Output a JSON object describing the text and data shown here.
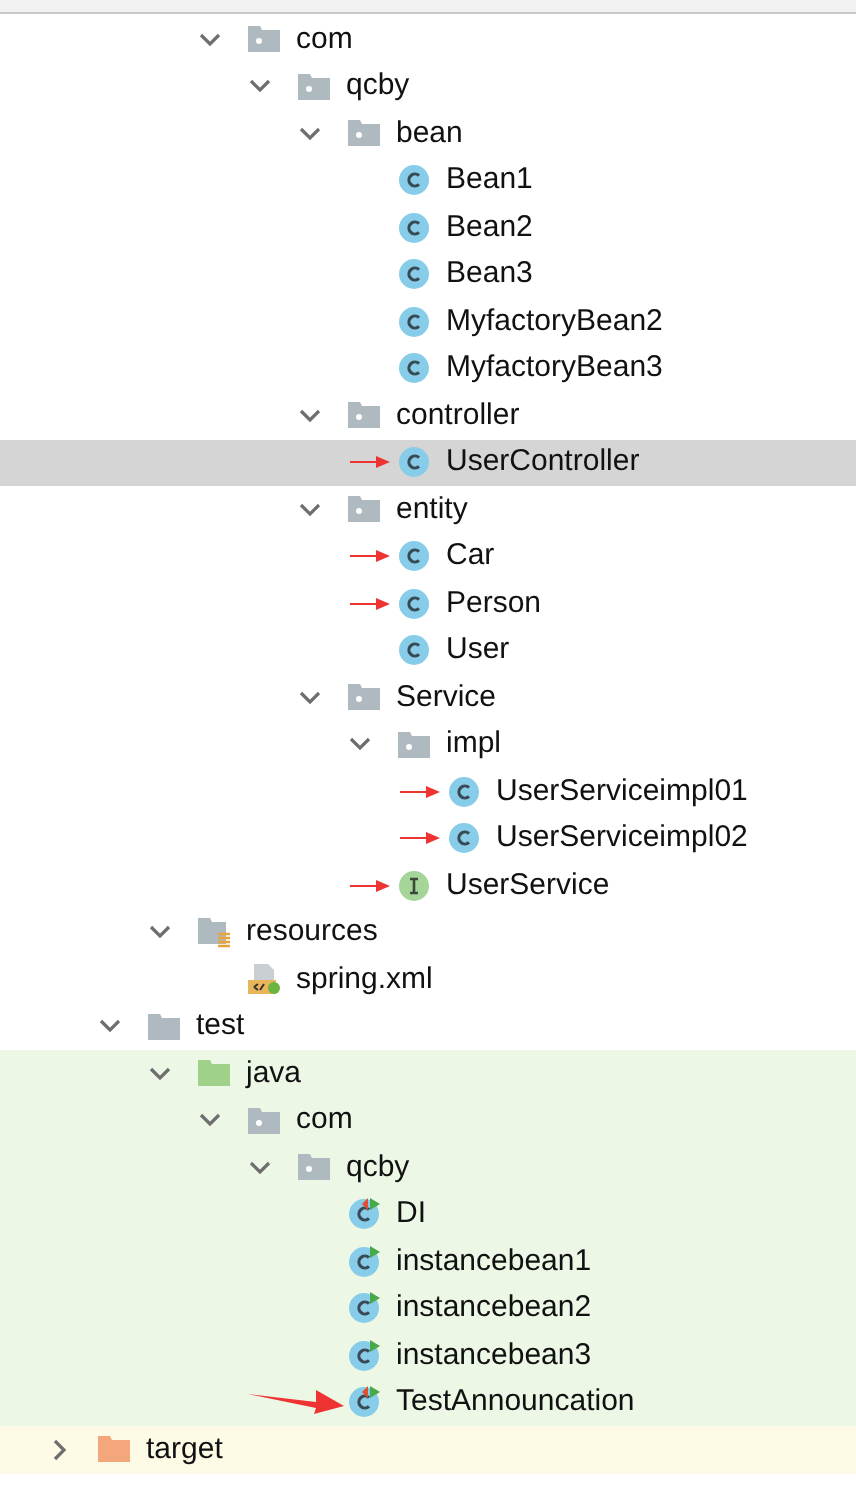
{
  "tree": [
    {
      "children": [
        {
          "children": [
            {
              "children": [
                {
                  "label": "com",
                  "kind": "package",
                  "expanded": true,
                  "selected": false,
                  "marked": false,
                  "children": [
                    {
                      "label": "qcby",
                      "kind": "package",
                      "expanded": true,
                      "selected": false,
                      "marked": false,
                      "children": [
                        {
                          "label": "bean",
                          "kind": "package",
                          "expanded": true,
                          "selected": false,
                          "marked": false,
                          "children": [
                            {
                              "label": "Bean1",
                              "kind": "class",
                              "selected": false,
                              "marked": false
                            },
                            {
                              "label": "Bean2",
                              "kind": "class",
                              "selected": false,
                              "marked": false
                            },
                            {
                              "label": "Bean3",
                              "kind": "class",
                              "selected": false,
                              "marked": false
                            },
                            {
                              "label": "MyfactoryBean2",
                              "kind": "class",
                              "selected": false,
                              "marked": false
                            },
                            {
                              "label": "MyfactoryBean3",
                              "kind": "class",
                              "selected": false,
                              "marked": false
                            }
                          ]
                        },
                        {
                          "label": "controller",
                          "kind": "package",
                          "expanded": true,
                          "selected": false,
                          "marked": false,
                          "children": [
                            {
                              "label": "UserController",
                              "kind": "class",
                              "selected": true,
                              "marked": true
                            }
                          ]
                        },
                        {
                          "label": "entity",
                          "kind": "package",
                          "expanded": true,
                          "selected": false,
                          "marked": false,
                          "children": [
                            {
                              "label": "Car",
                              "kind": "class",
                              "selected": false,
                              "marked": true
                            },
                            {
                              "label": "Person",
                              "kind": "class",
                              "selected": false,
                              "marked": true
                            },
                            {
                              "label": "User",
                              "kind": "class",
                              "selected": false,
                              "marked": false
                            }
                          ]
                        },
                        {
                          "label": "Service",
                          "kind": "package",
                          "expanded": true,
                          "selected": false,
                          "marked": false,
                          "children": [
                            {
                              "label": "impl",
                              "kind": "package",
                              "expanded": true,
                              "selected": false,
                              "marked": false,
                              "children": [
                                {
                                  "label": "UserServiceimpl01",
                                  "kind": "class",
                                  "selected": false,
                                  "marked": true
                                },
                                {
                                  "label": "UserServiceimpl02",
                                  "kind": "class",
                                  "selected": false,
                                  "marked": true
                                }
                              ]
                            },
                            {
                              "label": "UserService",
                              "kind": "interface",
                              "selected": false,
                              "marked": true
                            }
                          ]
                        }
                      ]
                    }
                  ]
                }
              ]
            },
            {
              "label": "resources",
              "kind": "resources",
              "expanded": true,
              "selected": false,
              "marked": false,
              "children": [
                {
                  "label": "spring.xml",
                  "kind": "xml",
                  "selected": false,
                  "marked": false
                }
              ]
            }
          ]
        },
        {
          "label": "test",
          "kind": "folder",
          "expanded": true,
          "selected": false,
          "marked": false,
          "children": [
            {
              "label": "java",
              "kind": "test-root",
              "test_source": true,
              "expanded": true,
              "selected": false,
              "marked": false,
              "children": [
                {
                  "label": "com",
                  "kind": "package",
                  "expanded": true,
                  "selected": false,
                  "marked": false,
                  "children": [
                    {
                      "label": "qcby",
                      "kind": "package",
                      "expanded": true,
                      "selected": false,
                      "marked": false,
                      "children": [
                        {
                          "label": "DI",
                          "kind": "test-class-failed",
                          "selected": false,
                          "marked": false
                        },
                        {
                          "label": "instancebean1",
                          "kind": "test-class",
                          "selected": false,
                          "marked": false
                        },
                        {
                          "label": "instancebean2",
                          "kind": "test-class",
                          "selected": false,
                          "marked": false
                        },
                        {
                          "label": "instancebean3",
                          "kind": "test-class",
                          "selected": false,
                          "marked": false
                        },
                        {
                          "label": "TestAnnouncation",
                          "kind": "test-class-failed",
                          "selected": false,
                          "marked": true
                        }
                      ]
                    }
                  ]
                }
              ]
            }
          ]
        }
      ]
    },
    {
      "label": "target",
      "kind": "excluded",
      "excluded": true,
      "expanded": false,
      "selected": false,
      "marked": false
    }
  ]
}
